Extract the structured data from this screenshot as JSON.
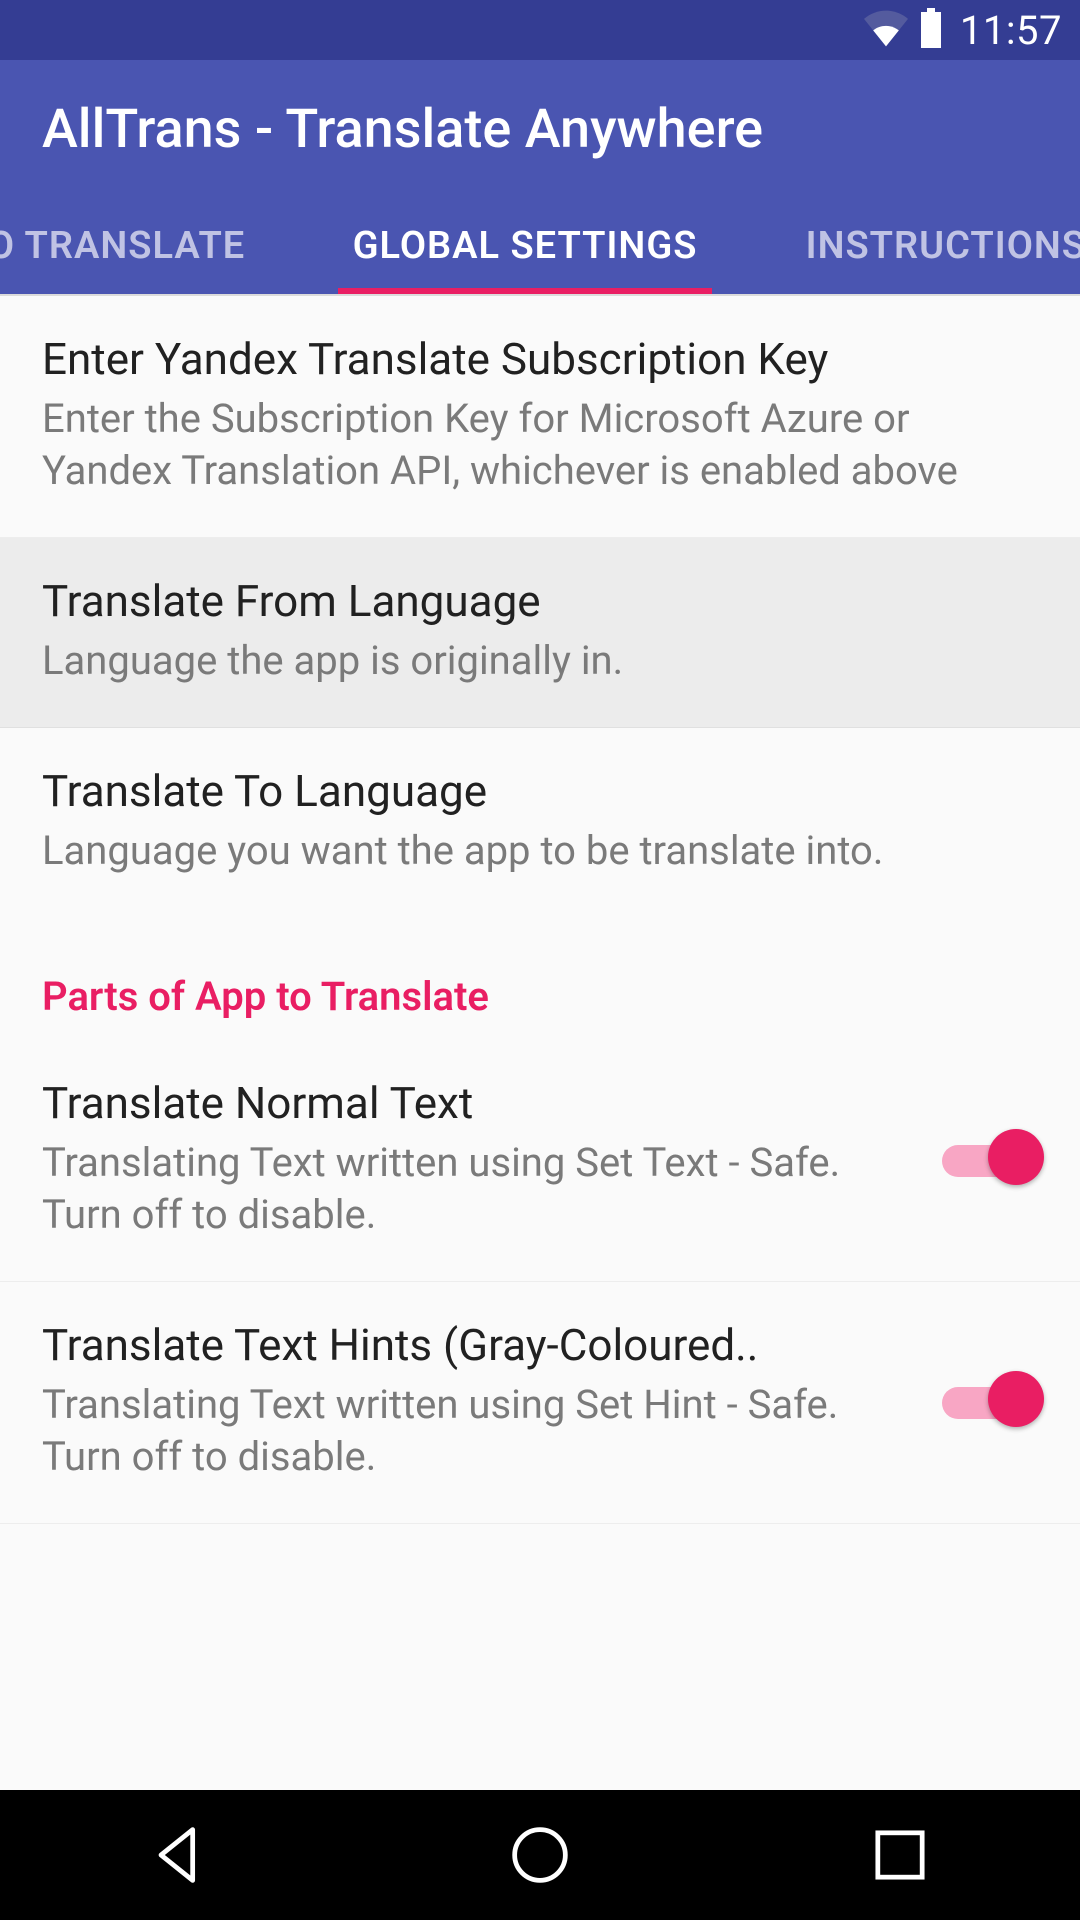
{
  "status": {
    "time": "11:57"
  },
  "header": {
    "title": "AllTrans - Translate Anywhere"
  },
  "tabs": {
    "to_translate": "TO TRANSLATE",
    "global_settings": "GLOBAL SETTINGS",
    "instructions": "INSTRUCTIONS"
  },
  "settings": {
    "yandex_key": {
      "title": "Enter Yandex Translate Subscription Key",
      "subtitle": "Enter the Subscription Key for Microsoft Azure or Yandex Translation API, whichever is enabled above"
    },
    "from_lang": {
      "title": "Translate From Language",
      "subtitle": "Language the app is originally in."
    },
    "to_lang": {
      "title": "Translate To Language",
      "subtitle": "Language you want the app to be translate into."
    },
    "section_parts": "Parts of App to Translate",
    "translate_normal": {
      "title": "Translate Normal Text",
      "subtitle": "Translating Text written using Set Text - Safe. Turn off to disable.",
      "on": true
    },
    "translate_hints": {
      "title": "Translate Text Hints (Gray-Coloured..",
      "subtitle": "Translating Text written using Set Hint - Safe. Turn off to disable.",
      "on": true
    }
  }
}
